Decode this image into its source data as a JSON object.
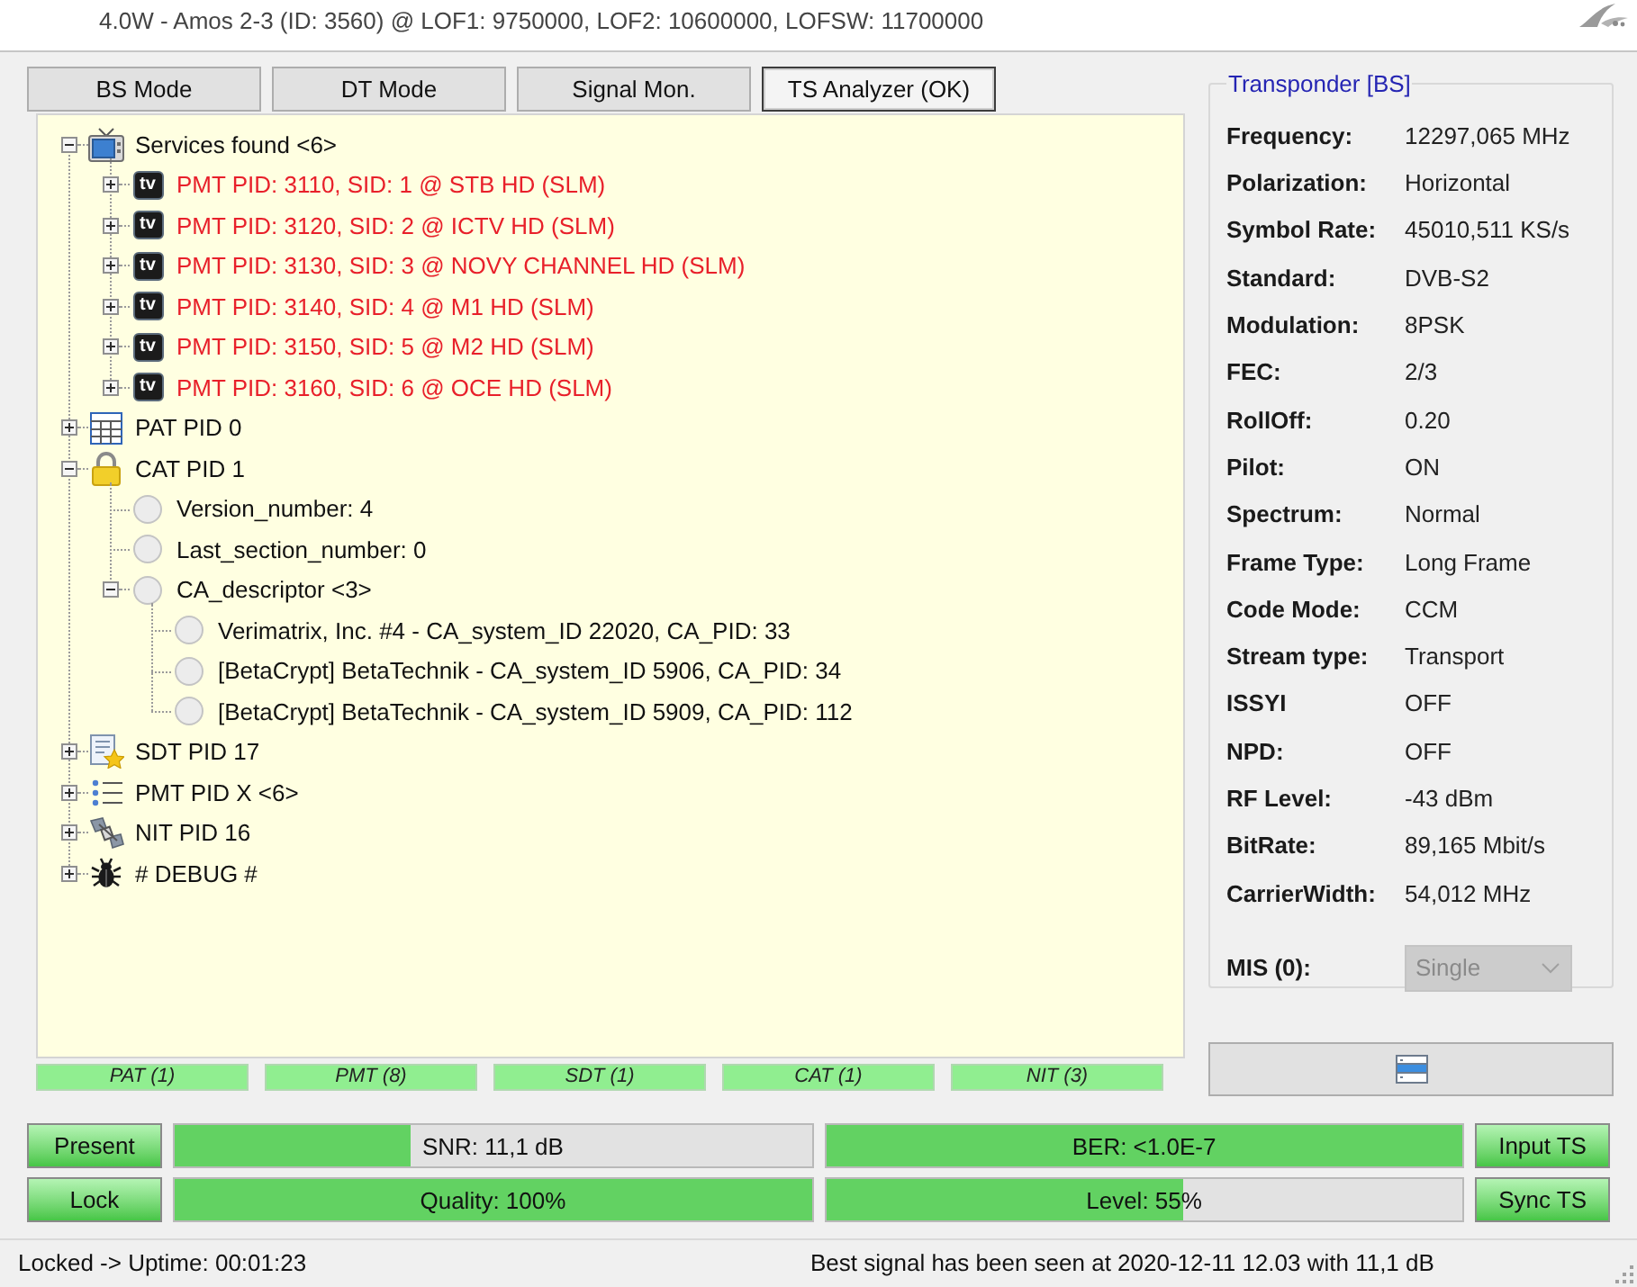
{
  "header": {
    "text": "4.0W - Amos 2-3 (ID: 3560) @ LOF1: 9750000, LOF2: 10600000, LOFSW: 11700000"
  },
  "modes": [
    {
      "label": "BS Mode",
      "selected": false
    },
    {
      "label": "DT Mode",
      "selected": false
    },
    {
      "label": "Signal Mon.",
      "selected": false
    },
    {
      "label": "TS Analyzer (OK)",
      "selected": true
    }
  ],
  "tree": [
    {
      "label": "Services found <6>",
      "kind": "television",
      "expanded": true,
      "children": [
        {
          "label": "PMT PID: 3110, SID: 1 @ STB HD (SLM)",
          "kind": "tv",
          "badge": "tv",
          "expanded": false,
          "color": "#e8202a"
        },
        {
          "label": "PMT PID: 3120, SID: 2 @ ICTV HD (SLM)",
          "kind": "tv",
          "badge": "tv",
          "expanded": false,
          "color": "#e8202a"
        },
        {
          "label": "PMT PID: 3130, SID: 3 @ NOVY CHANNEL HD (SLM)",
          "kind": "tv",
          "badge": "tv",
          "expanded": false,
          "color": "#e8202a"
        },
        {
          "label": "PMT PID: 3140, SID: 4 @ M1 HD (SLM)",
          "kind": "tv",
          "badge": "tv",
          "expanded": false,
          "color": "#e8202a"
        },
        {
          "label": "PMT PID: 3150, SID: 5 @ M2 HD (SLM)",
          "kind": "tv",
          "badge": "tv",
          "expanded": false,
          "color": "#e8202a"
        },
        {
          "label": "PMT PID: 3160, SID: 6 @ OCE HD (SLM)",
          "kind": "tv",
          "badge": "tv",
          "expanded": false,
          "color": "#e8202a"
        }
      ]
    },
    {
      "label": "PAT PID 0",
      "kind": "table",
      "expanded": false
    },
    {
      "label": "CAT PID 1",
      "kind": "lock",
      "expanded": true,
      "children": [
        {
          "label": "Version_number: 4",
          "kind": "circle"
        },
        {
          "label": "Last_section_number: 0",
          "kind": "circle"
        },
        {
          "label": "CA_descriptor <3>",
          "kind": "circle",
          "expanded": true,
          "children": [
            {
              "label": "Verimatrix, Inc. #4 - CA_system_ID 22020, CA_PID: 33",
              "kind": "circle"
            },
            {
              "label": "[BetaCrypt] BetaTechnik - CA_system_ID 5906, CA_PID: 34",
              "kind": "circle"
            },
            {
              "label": "[BetaCrypt] BetaTechnik - CA_system_ID 5909, CA_PID: 112",
              "kind": "circle"
            }
          ]
        }
      ]
    },
    {
      "label": "SDT PID 17",
      "kind": "document-star",
      "expanded": false
    },
    {
      "label": "PMT PID X <6>",
      "kind": "list",
      "expanded": false
    },
    {
      "label": "NIT PID 16",
      "kind": "satellite",
      "expanded": false
    },
    {
      "label": "# DEBUG #",
      "kind": "bug",
      "expanded": false
    }
  ],
  "tables": [
    {
      "label": "PAT (1)",
      "on": true
    },
    {
      "label": "PMT (8)",
      "on": true
    },
    {
      "label": "SDT (1)",
      "on": true
    },
    {
      "label": "CAT (1)",
      "on": true
    },
    {
      "label": "NIT (3)",
      "on": true
    }
  ],
  "transponder": {
    "title": "Transponder [BS]",
    "fields": [
      {
        "label": "Frequency:",
        "value": "12297,065 MHz"
      },
      {
        "label": "Polarization:",
        "value": "Horizontal"
      },
      {
        "label": "Symbol Rate:",
        "value": "45010,511 KS/s"
      },
      {
        "label": "Standard:",
        "value": "DVB-S2"
      },
      {
        "label": "Modulation:",
        "value": "8PSK"
      },
      {
        "label": "FEC:",
        "value": "2/3"
      },
      {
        "label": "RollOff:",
        "value": "0.20"
      },
      {
        "label": "Pilot:",
        "value": "ON"
      },
      {
        "label": "Spectrum:",
        "value": "Normal"
      },
      {
        "label": "Frame Type:",
        "value": "Long Frame"
      },
      {
        "label": "Code Mode:",
        "value": "CCM"
      },
      {
        "label": "Stream type:",
        "value": "Transport"
      },
      {
        "label": "ISSYI",
        "value": "OFF"
      },
      {
        "label": "NPD:",
        "value": "OFF"
      },
      {
        "label": "RF Level:",
        "value": "-43 dBm"
      },
      {
        "label": "BitRate:",
        "value": "89,165 Mbit/s"
      },
      {
        "label": "CarrierWidth:",
        "value": "54,012 MHz"
      }
    ],
    "mis": {
      "label": "MIS (0):",
      "value": "Single",
      "disabled": true
    }
  },
  "signal_rows": [
    {
      "indicator": {
        "label": "Present",
        "on": true
      },
      "meters": [
        {
          "kind": "snr",
          "label": "SNR: 11,1 dB",
          "level": 0.37
        },
        {
          "kind": "ber",
          "label": "BER: <1.0E-7",
          "level": 1
        }
      ],
      "status": {
        "label": "Input TS",
        "on": true
      }
    },
    {
      "indicator": {
        "label": "Lock",
        "on": true
      },
      "meters": [
        {
          "kind": "quality",
          "label": "Quality: 100%",
          "level": 1
        },
        {
          "kind": "level",
          "label": "Level: 55%",
          "level": 0.56
        }
      ],
      "status": {
        "label": "Sync TS",
        "on": true
      }
    }
  ],
  "status_bar": {
    "left": "Locked -> Uptime: 00:01:23",
    "right": "Best signal has been seen at 2020-12-11 12.03 with 11,1 dB"
  }
}
